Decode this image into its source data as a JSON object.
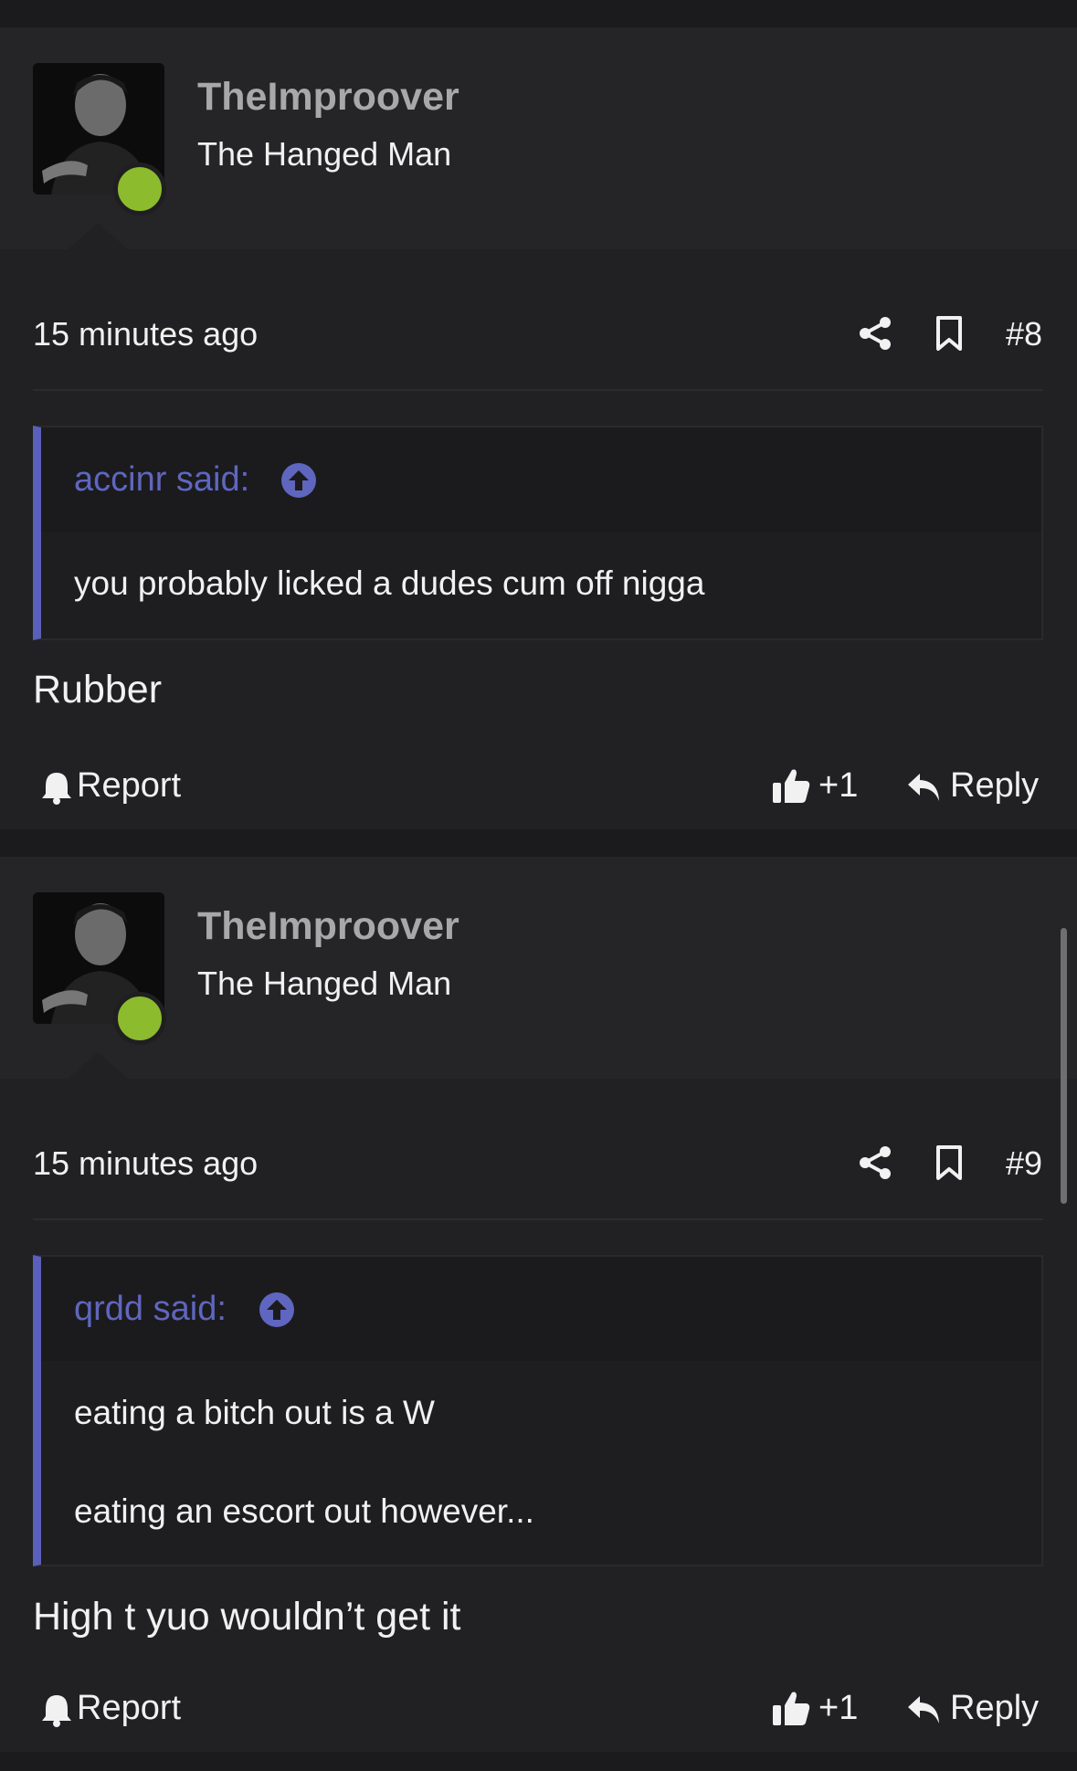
{
  "posts": [
    {
      "username": "TheImproover",
      "user_title": "The Hanged Man",
      "time": "15 minutes ago",
      "post_number": "#8",
      "quote": {
        "author": "accinr said:",
        "lines": [
          "you probably licked a dudes cum off nigga"
        ]
      },
      "message": "Rubber",
      "report_label": "Report",
      "like_count": "+1",
      "reply_label": "Reply"
    },
    {
      "username": "TheImproover",
      "user_title": "The Hanged Man",
      "time": "15 minutes ago",
      "post_number": "#9",
      "quote": {
        "author": "qrdd said:",
        "lines": [
          "eating a bitch out is a W",
          "eating an escort out however..."
        ]
      },
      "message": "High t yuo wouldn’t get it",
      "report_label": "Report",
      "like_count": "+1",
      "reply_label": "Reply"
    }
  ],
  "icons": {
    "online_indicator_color": "#8cbb2d",
    "quote_accent_color": "#5f66bf"
  }
}
